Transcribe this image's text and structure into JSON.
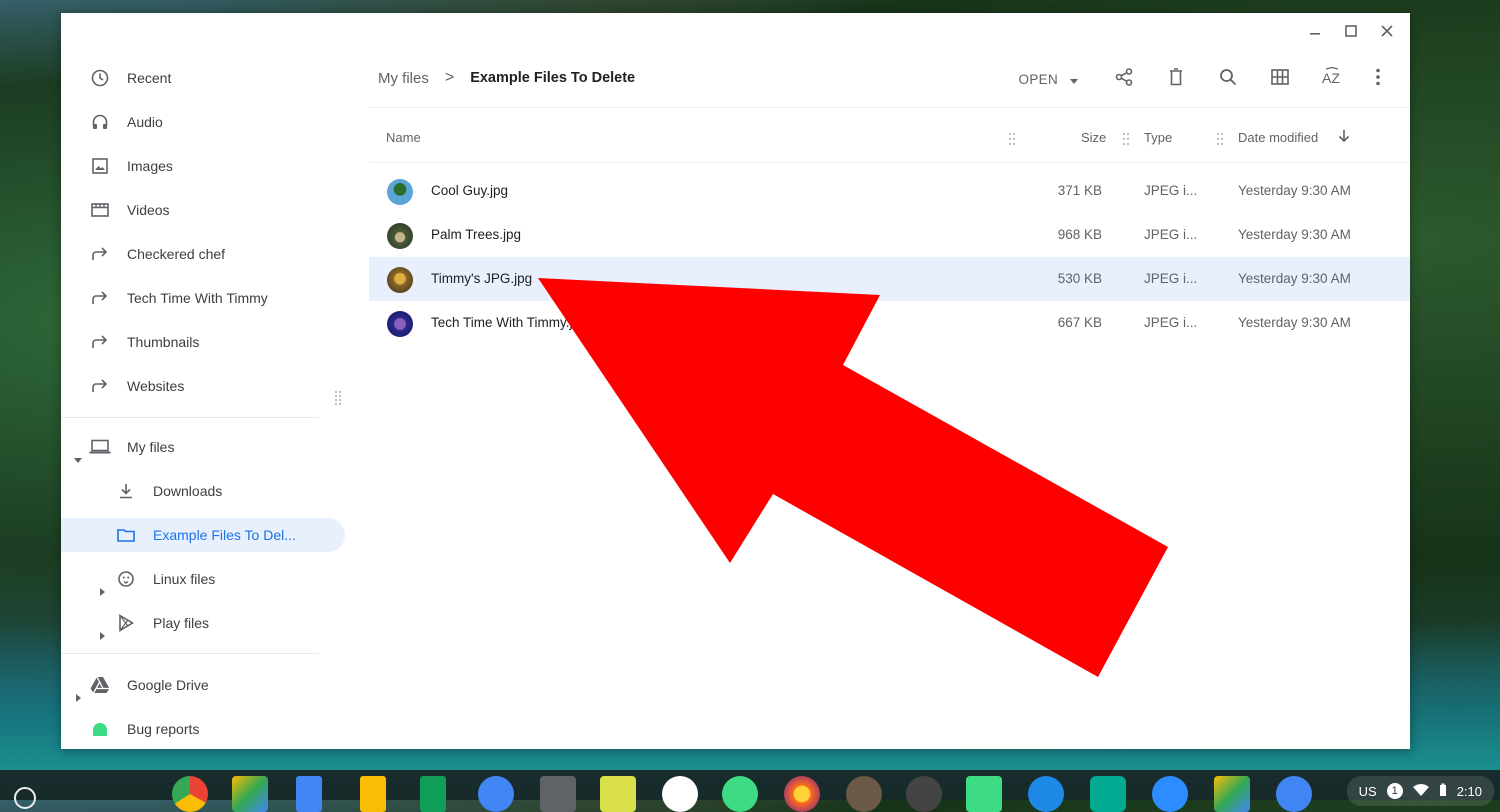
{
  "window": {
    "controls": [
      "minimize-icon",
      "maximize-icon",
      "close-icon"
    ]
  },
  "sidebar": {
    "recent_items": [
      {
        "label": "Recent",
        "icon": "clock-icon"
      },
      {
        "label": "Audio",
        "icon": "headphones-icon"
      },
      {
        "label": "Images",
        "icon": "image-icon"
      },
      {
        "label": "Videos",
        "icon": "film-icon"
      }
    ],
    "shortcuts": [
      {
        "label": "Checkered chef",
        "icon": "shortcut-arrow-icon"
      },
      {
        "label": "Tech Time With Timmy",
        "icon": "shortcut-arrow-icon"
      },
      {
        "label": "Thumbnails",
        "icon": "shortcut-arrow-icon"
      },
      {
        "label": "Websites",
        "icon": "shortcut-arrow-icon"
      }
    ],
    "my_files": {
      "label": "My files",
      "icon": "laptop-icon"
    },
    "downloads": {
      "label": "Downloads",
      "icon": "download-icon"
    },
    "example_folder": {
      "label": "Example Files To Del...",
      "icon": "folder-icon"
    },
    "linux_files": {
      "label": "Linux files",
      "icon": "penguin-icon"
    },
    "play_files": {
      "label": "Play files",
      "icon": "play-store-icon"
    },
    "google_drive": {
      "label": "Google Drive",
      "icon": "drive-icon"
    },
    "bug_reports": {
      "label": "Bug reports",
      "icon": "android-icon"
    }
  },
  "breadcrumb": {
    "root": "My files",
    "separator": ">",
    "current": "Example Files To Delete"
  },
  "toolbar": {
    "open_label": "OPEN",
    "buttons": [
      "share-icon",
      "trash-icon",
      "search-icon",
      "grid-view-icon",
      "sort-az-icon",
      "more-vert-icon"
    ]
  },
  "columns": {
    "name": "Name",
    "size": "Size",
    "type": "Type",
    "date": "Date modified"
  },
  "files": [
    {
      "name": "Cool Guy.jpg",
      "size": "371 KB",
      "type": "JPEG i...",
      "date": "Yesterday 9:30 AM",
      "thumb_color": "#5ba4d6"
    },
    {
      "name": "Palm Trees.jpg",
      "size": "968 KB",
      "type": "JPEG i...",
      "date": "Yesterday 9:30 AM",
      "thumb_color": "#4a5a3a"
    },
    {
      "name": "Timmy's JPG.jpg",
      "size": "530 KB",
      "type": "JPEG i...",
      "date": "Yesterday 9:30 AM",
      "thumb_color": "#8a6a2a"
    },
    {
      "name": "Tech Time With Timmy.jpg",
      "size": "667 KB",
      "type": "JPEG i...",
      "date": "Yesterday 9:30 AM",
      "thumb_color": "#2a2a8a"
    }
  ],
  "shelf": {
    "apps": [
      "chrome-icon",
      "google-drive-icon",
      "google-docs-icon",
      "google-keep-icon",
      "google-sheets-icon",
      "files-icon",
      "screen-capture-icon",
      "notes-icon",
      "play-store-icon",
      "android-icon",
      "firefox-icon",
      "gimp-icon",
      "linux-icon",
      "android-studio-icon",
      "vpn-icon",
      "pinterest-icon",
      "zoom-icon",
      "drive-icon",
      "settings-icon"
    ],
    "tray": {
      "locale": "US",
      "notifications": "1",
      "time": "2:10"
    }
  },
  "colors": {
    "accent": "#1a73e8",
    "selection": "#e8f0fe",
    "arrow": "#ff0000"
  }
}
